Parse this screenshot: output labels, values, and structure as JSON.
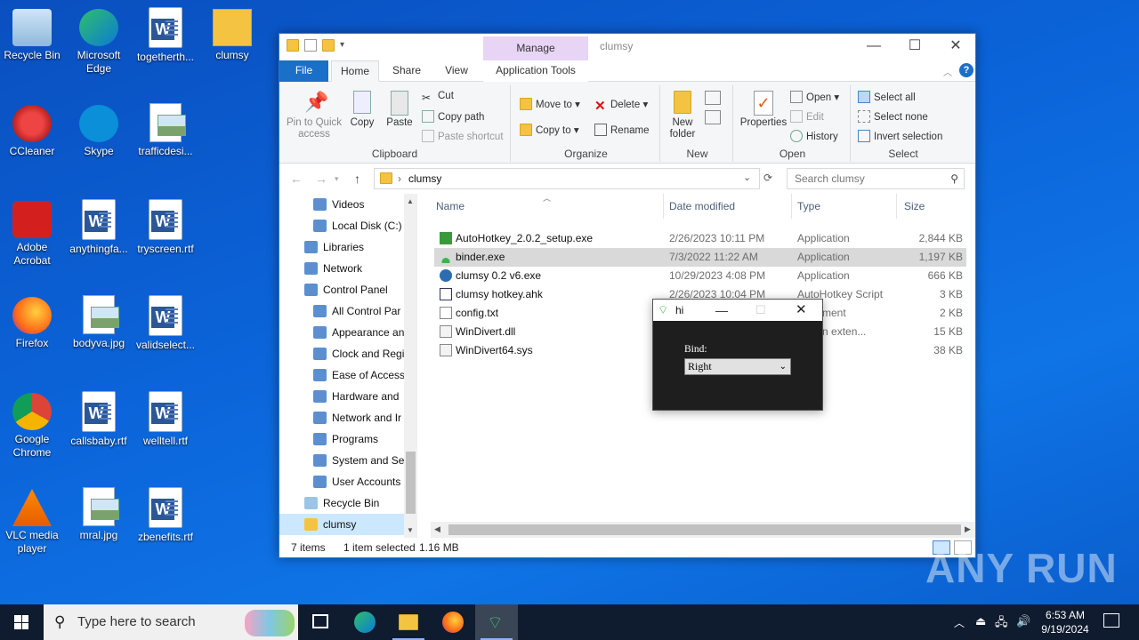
{
  "desktop": {
    "icons": [
      {
        "label": "Recycle Bin",
        "icon": "recycle-bin-icon"
      },
      {
        "label": "Microsoft Edge",
        "icon": "edge-icon"
      },
      {
        "label": "togetherth...",
        "icon": "word-document-icon"
      },
      {
        "label": "clumsy",
        "icon": "folder-icon"
      },
      {
        "label": "CCleaner",
        "icon": "ccleaner-icon"
      },
      {
        "label": "Skype",
        "icon": "skype-icon"
      },
      {
        "label": "trafficdesi...",
        "icon": "image-file-icon"
      },
      {
        "label": "Adobe Acrobat",
        "icon": "acrobat-icon"
      },
      {
        "label": "anythingfa...",
        "icon": "word-document-icon"
      },
      {
        "label": "tryscreen.rtf",
        "icon": "word-document-icon"
      },
      {
        "label": "Firefox",
        "icon": "firefox-icon"
      },
      {
        "label": "bodyva.jpg",
        "icon": "image-file-icon"
      },
      {
        "label": "validselect...",
        "icon": "word-document-icon"
      },
      {
        "label": "Google Chrome",
        "icon": "chrome-icon"
      },
      {
        "label": "callsbaby.rtf",
        "icon": "word-document-icon"
      },
      {
        "label": "welltell.rtf",
        "icon": "word-document-icon"
      },
      {
        "label": "VLC media player",
        "icon": "vlc-icon"
      },
      {
        "label": "mral.jpg",
        "icon": "image-file-icon"
      },
      {
        "label": "zbenefits.rtf",
        "icon": "word-document-icon"
      }
    ]
  },
  "explorer": {
    "title": "clumsy",
    "manage_label": "Manage",
    "tabs": {
      "file": "File",
      "home": "Home",
      "share": "Share",
      "view": "View",
      "app_tools": "Application Tools"
    },
    "ribbon": {
      "pin": "Pin to Quick access",
      "copy": "Copy",
      "paste": "Paste",
      "cut": "Cut",
      "copy_path": "Copy path",
      "paste_shortcut": "Paste shortcut",
      "clipboard": "Clipboard",
      "move_to": "Move to",
      "copy_to": "Copy to",
      "delete": "Delete",
      "rename": "Rename",
      "organize": "Organize",
      "new_folder": "New folder",
      "new": "New",
      "properties": "Properties",
      "open": "Open",
      "edit": "Edit",
      "history": "History",
      "open_group": "Open",
      "select_all": "Select all",
      "select_none": "Select none",
      "invert_selection": "Invert selection",
      "select_group": "Select"
    },
    "address": {
      "path": "clumsy",
      "search_placeholder": "Search clumsy"
    },
    "nav": [
      {
        "label": "Videos",
        "icon": "videos-icon",
        "indent": 1
      },
      {
        "label": "Local Disk (C:)",
        "icon": "drive-icon",
        "indent": 1
      },
      {
        "label": "Libraries",
        "icon": "libraries-icon",
        "indent": 0
      },
      {
        "label": "Network",
        "icon": "network-icon",
        "indent": 0
      },
      {
        "label": "Control Panel",
        "icon": "control-panel-icon",
        "indent": 0
      },
      {
        "label": "All Control Par",
        "icon": "control-panel-icon",
        "indent": 1
      },
      {
        "label": "Appearance an",
        "icon": "appearance-icon",
        "indent": 1
      },
      {
        "label": "Clock and Regi",
        "icon": "clock-icon",
        "indent": 1
      },
      {
        "label": "Ease of Access",
        "icon": "ease-access-icon",
        "indent": 1
      },
      {
        "label": "Hardware and",
        "icon": "hardware-icon",
        "indent": 1
      },
      {
        "label": "Network and Ir",
        "icon": "network-icon",
        "indent": 1
      },
      {
        "label": "Programs",
        "icon": "programs-icon",
        "indent": 1
      },
      {
        "label": "System and Sec",
        "icon": "system-icon",
        "indent": 1
      },
      {
        "label": "User Accounts",
        "icon": "user-accounts-icon",
        "indent": 1
      },
      {
        "label": "Recycle Bin",
        "icon": "recycle-bin-icon",
        "indent": 0
      },
      {
        "label": "clumsy",
        "icon": "folder-icon",
        "indent": 0
      }
    ],
    "columns": {
      "name": "Name",
      "date": "Date modified",
      "type": "Type",
      "size": "Size"
    },
    "files": [
      {
        "name": "AutoHotkey_2.0.2_setup.exe",
        "date": "2/26/2023 10:11 PM",
        "type": "Application",
        "size": "2,844 KB",
        "icon": "autohotkey-setup-icon"
      },
      {
        "name": "binder.exe",
        "date": "7/3/2022 11:22 AM",
        "type": "Application",
        "size": "1,197 KB",
        "icon": "wifi-icon"
      },
      {
        "name": "clumsy 0.2 v6.exe",
        "date": "10/29/2023 4:08 PM",
        "type": "Application",
        "size": "666 KB",
        "icon": "clumsy-app-icon"
      },
      {
        "name": "clumsy hotkey.ahk",
        "date": "2/26/2023 10:04 PM",
        "type": "AutoHotkey Script",
        "size": "3 KB",
        "icon": "ahk-script-icon"
      },
      {
        "name": "config.txt",
        "date": "",
        "type": "Document",
        "size": "2 KB",
        "icon": "text-file-icon"
      },
      {
        "name": "WinDivert.dll",
        "date": "",
        "type": "ication exten...",
        "size": "15 KB",
        "icon": "dll-icon"
      },
      {
        "name": "WinDivert64.sys",
        "date": "",
        "type": "m file",
        "size": "38 KB",
        "icon": "sys-file-icon"
      }
    ],
    "status": {
      "count": "7 items",
      "selected": "1 item selected",
      "size": "1.16 MB"
    }
  },
  "dialog": {
    "title": "hi",
    "label": "Bind:",
    "value": "Right"
  },
  "taskbar": {
    "search": "Type here to search",
    "time": "6:53 AM",
    "date": "9/19/2024"
  },
  "watermark": "ANY RUN"
}
